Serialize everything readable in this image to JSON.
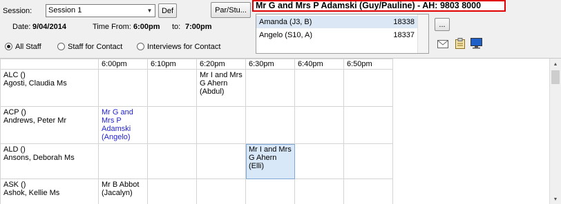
{
  "session": {
    "label": "Session:",
    "value": "Session 1",
    "def_button": "Def"
  },
  "info": {
    "date_label": "Date:",
    "date_value": "9/04/2014",
    "time_from_label": "Time From:",
    "time_from_value": "6:00pm",
    "to_label": "to:",
    "to_value": "7:00pm"
  },
  "filters": {
    "all_staff": "All Staff",
    "staff_for_contact": "Staff for Contact",
    "interviews_for_contact": "Interviews for Contact",
    "selected": "all_staff"
  },
  "par_button": "Par/Stu...",
  "parent_heading": "Mr G and Mrs P Adamski (Guy/Pauline) - AH: 9803 8000",
  "students": [
    {
      "name": "Amanda (J3, B)",
      "code": "18338",
      "selected": true
    },
    {
      "name": "Angelo (S10, A)",
      "code": "18337",
      "selected": false
    }
  ],
  "more_button": "...",
  "toolbar_icons": [
    "envelope-icon",
    "clipboard-icon",
    "monitor-icon"
  ],
  "grid": {
    "times": [
      "6:00pm",
      "6:10pm",
      "6:20pm",
      "6:30pm",
      "6:40pm",
      "6:50pm"
    ],
    "rows": [
      {
        "code": "ALC ()",
        "name": "Agosti, Claudia Ms",
        "cells": [
          "",
          "",
          "Mr I and Mrs G Ahern (Abdul)",
          "",
          "",
          ""
        ]
      },
      {
        "code": "ACP ()",
        "name": "Andrews, Peter Mr",
        "cells": [
          "Mr G and Mrs P Adamski (Angelo)",
          "",
          "",
          "",
          "",
          ""
        ]
      },
      {
        "code": "ALD ()",
        "name": "Ansons, Deborah Ms",
        "cells": [
          "",
          "",
          "",
          "Mr I and Mrs G Ahern (Elli)",
          "",
          ""
        ]
      },
      {
        "code": "ASK ()",
        "name": "Ashok, Kellie Ms",
        "cells": [
          "Mr B Abbot (Jacalyn)",
          "",
          "",
          "",
          "",
          ""
        ]
      }
    ]
  },
  "colors": {
    "highlight_border": "#e00000",
    "contact_text": "#1f1fd0",
    "selected_cell": "#d8e8f8"
  }
}
